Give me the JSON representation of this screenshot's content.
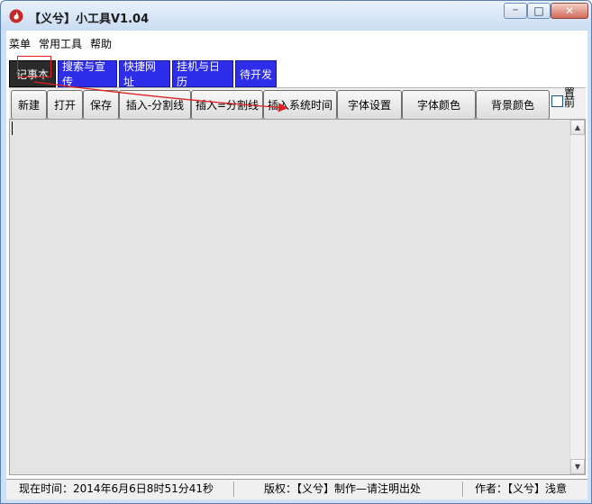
{
  "window": {
    "title": "【义兮】小工具V1.04",
    "controls": {
      "minimize": "─",
      "maximize": "□",
      "close": "✕"
    }
  },
  "menu": [
    "菜单",
    "常用工具",
    "帮助"
  ],
  "tabs": [
    "记事本",
    "搜索与宣传",
    "快捷网址",
    "挂机与日历",
    "待开发"
  ],
  "toolbar": {
    "buttons": [
      "新建",
      "打开",
      "保存",
      "插入-分割线",
      "插入=分割线",
      "插入系统时间",
      "字体设置",
      "字体颜色",
      "背景颜色"
    ],
    "pin_label": "置前"
  },
  "editor": {
    "text": ""
  },
  "status": {
    "time": "现在时间：2014年6月6日8时51分41秒",
    "copyright": "版权：【义兮】制作—请注明出处",
    "author": "作者：【义兮】浅意"
  },
  "colors": {
    "tab_bg": "#2d2dea",
    "tab_active_bg": "#2a2a2a",
    "annotation": "#e02020"
  },
  "icons": {
    "app": "flame-icon"
  }
}
